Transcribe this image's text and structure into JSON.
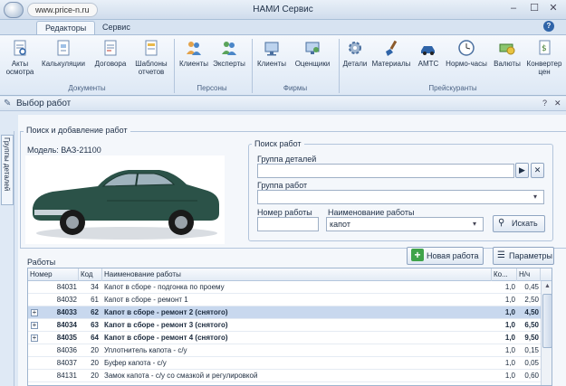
{
  "window": {
    "title": "НАМИ Сервис",
    "watermark": "www.price-n.ru",
    "minimize": "‒",
    "maximize": "☐",
    "close": "✕"
  },
  "ribbon_tabs": [
    "Редакторы",
    "Сервис"
  ],
  "ribbon": {
    "groups": {
      "documents": "Документы",
      "persons": "Персоны",
      "firms": "Фирмы",
      "price_lists": "Прейскуранты"
    },
    "buttons": {
      "acts": "Акты\nосмотра",
      "calcs": "Калькуляции",
      "contracts": "Договора",
      "templates": "Шаблоны\nотчетов",
      "clients_p": "Клиенты",
      "experts": "Эксперты",
      "clients_f": "Клиенты",
      "appraisers": "Оценщики",
      "parts": "Детали",
      "materials": "Материалы",
      "amts": "АМТС",
      "norm_hours": "Нормо-часы",
      "currencies": "Валюты",
      "converter": "Конвертер\nцен"
    }
  },
  "doc_title": "Выбор работ",
  "side_tab": "Группы деталей",
  "fieldset_title": "Поиск и добавление работ",
  "model_label": "Модель: ВАЗ-21100",
  "search": {
    "title": "Поиск работ",
    "parts_group_label": "Группа деталей",
    "parts_group_value": "",
    "works_group_label": "Группа работ",
    "works_group_value": "",
    "work_number_label": "Номер работы",
    "work_number_value": "",
    "work_name_label": "Наименование работы",
    "work_name_value": "капот",
    "search_button": "Искать"
  },
  "works_label": "Работы",
  "new_work_button": "Новая работа",
  "params_button": "Параметры",
  "grid": {
    "headers": [
      "Номер",
      "Код",
      "Наименование работы",
      "Ко...",
      "Н/ч"
    ],
    "rows": [
      {
        "num": "84031",
        "code": "34",
        "name": "Капот в сборе - подгонка по проему",
        "k": "1,0",
        "nh": "0,45",
        "bold": false,
        "sel": false
      },
      {
        "num": "84032",
        "code": "61",
        "name": "Капот в сборе - ремонт 1",
        "k": "1,0",
        "nh": "2,50",
        "bold": false,
        "sel": false
      },
      {
        "num": "84033",
        "code": "62",
        "name": "Капот в сборе - ремонт 2 (снятого)",
        "k": "1,0",
        "nh": "4,50",
        "bold": true,
        "sel": true
      },
      {
        "num": "84034",
        "code": "63",
        "name": "Капот в сборе - ремонт 3 (снятого)",
        "k": "1,0",
        "nh": "6,50",
        "bold": true,
        "sel": false
      },
      {
        "num": "84035",
        "code": "64",
        "name": "Капот в сборе - ремонт 4 (снятого)",
        "k": "1,0",
        "nh": "9,50",
        "bold": true,
        "sel": false
      },
      {
        "num": "84036",
        "code": "20",
        "name": "Уплотнитель капота - с/у",
        "k": "1,0",
        "nh": "0,15",
        "bold": false,
        "sel": false
      },
      {
        "num": "84037",
        "code": "20",
        "name": "Буфер капота - с/у",
        "k": "1,0",
        "nh": "0,05",
        "bold": false,
        "sel": false
      },
      {
        "num": "84131",
        "code": "20",
        "name": "Замок капота - с/у со смазкой и регулировкой",
        "k": "1,0",
        "nh": "0,60",
        "bold": false,
        "sel": false
      }
    ]
  },
  "colors": {
    "accent": "#2f64a8",
    "selected_row": "#c8d8ee",
    "car_body": "#2b5248"
  }
}
